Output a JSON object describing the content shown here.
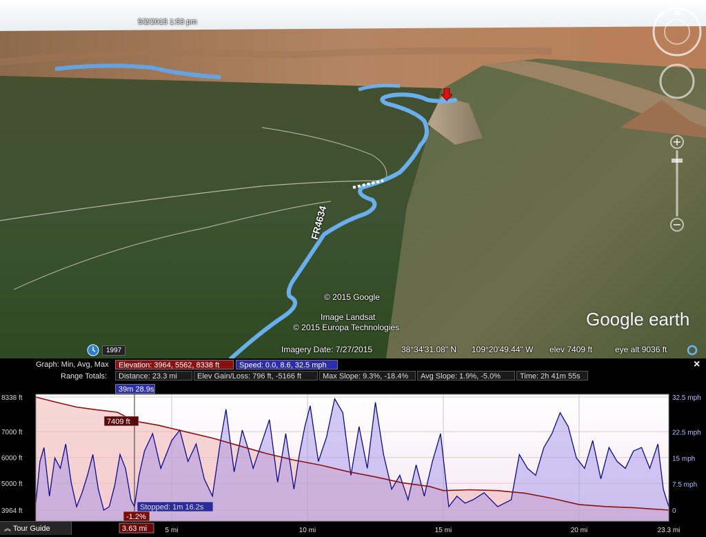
{
  "map": {
    "timestamp": "5/2/2015    1:53 pm",
    "road_label": "FR4634",
    "attribution": [
      "© 2015 Google",
      "Image Landsat",
      "© 2015 Europa Technologies"
    ],
    "logo": "Google earth",
    "historical_year": "1997",
    "status": {
      "imagery_date": "Imagery Date: 7/27/2015",
      "lat": "38°34'31.08\" N",
      "lon": "109°20'49.44\" W",
      "elev": "elev  7409 ft",
      "eye_alt": "eye alt   9036 ft"
    }
  },
  "graph_header": {
    "graph_label": "Graph: Min, Avg, Max",
    "elevation": "Elevation: 3964, 5562, 8338 ft",
    "speed": "Speed: 0.0, 8.6, 32.5 mph",
    "range_label": "Range Totals:",
    "distance": "Distance: 23.3 mi",
    "gain_loss": "Elev Gain/Loss: 796 ft, -5166 ft",
    "max_slope": "Max Slope: 9.3%, -18.4%",
    "avg_slope": "Avg Slope: 1.9%, -5.0%",
    "time": "Time: 2h 41m 55s",
    "close": "×"
  },
  "cursor": {
    "time": "39m 28.9s",
    "elevation": "7409 ft",
    "stopped": "Stopped: 1m 16.2s",
    "slope": "-1.2%",
    "distance": "3.63 mi",
    "distance_value": 3.63
  },
  "tour_guide": "Tour Guide",
  "colors": {
    "elevation": "#8b1010",
    "speed": "#0a0a8c",
    "route": "#5fa8f0"
  },
  "chart_data": {
    "type": "line",
    "xlim": [
      0,
      23.3
    ],
    "x_ticks": [
      "5 mi",
      "10 mi",
      "15 mi",
      "20 mi",
      "23.3 mi"
    ],
    "x_tick_values": [
      5,
      10,
      15,
      20,
      23.3
    ],
    "left_axis_ticks": [
      "8338 ft",
      "7000 ft",
      "6000 ft",
      "5000 ft",
      "3964 ft"
    ],
    "left_axis_values": [
      8338,
      7000,
      6000,
      5000,
      3964
    ],
    "right_axis_ticks": [
      "32.5 mph",
      "22.5 mph",
      "15 mph",
      "7.5 mph",
      "0"
    ],
    "right_axis_values": [
      32.5,
      22.5,
      15,
      7.5,
      0
    ],
    "series": [
      {
        "name": "Elevation",
        "unit": "ft",
        "x": [
          0,
          0.7,
          1.5,
          2.2,
          3,
          3.63,
          4.5,
          5.5,
          6.5,
          7.5,
          8.5,
          9.5,
          10.5,
          11.5,
          12.5,
          13.5,
          14.5,
          15,
          16,
          17,
          18,
          19,
          20,
          21,
          22,
          23.3
        ],
        "values": [
          8338,
          8150,
          7950,
          7850,
          7750,
          7409,
          7250,
          7000,
          6750,
          6450,
          6150,
          5900,
          5700,
          5450,
          5250,
          5020,
          4880,
          4720,
          4750,
          4720,
          4620,
          4420,
          4180,
          4100,
          4060,
          3964
        ]
      },
      {
        "name": "Speed",
        "unit": "mph",
        "x": [
          0,
          0.15,
          0.3,
          0.5,
          0.7,
          0.9,
          1.1,
          1.3,
          1.5,
          1.7,
          1.9,
          2.1,
          2.3,
          2.5,
          2.7,
          2.9,
          3.1,
          3.3,
          3.5,
          3.63,
          3.8,
          4.0,
          4.3,
          4.6,
          5.0,
          5.3,
          5.6,
          5.9,
          6.2,
          6.5,
          6.8,
          7.0,
          7.3,
          7.6,
          7.8,
          8.0,
          8.3,
          8.6,
          8.9,
          9.2,
          9.5,
          9.7,
          9.9,
          10.1,
          10.4,
          10.7,
          11.0,
          11.3,
          11.6,
          11.9,
          12.2,
          12.5,
          12.8,
          13.1,
          13.4,
          13.7,
          14.0,
          14.3,
          14.6,
          14.9,
          15.2,
          15.5,
          15.8,
          16.1,
          16.5,
          17.0,
          17.5,
          17.8,
          18.1,
          18.4,
          18.7,
          19.0,
          19.3,
          19.6,
          19.9,
          20.2,
          20.5,
          20.8,
          21.1,
          21.4,
          21.7,
          22.0,
          22.3,
          22.6,
          22.9,
          23.1,
          23.3
        ],
        "values": [
          2,
          14,
          18,
          4,
          15,
          12,
          19,
          8,
          1,
          5,
          10,
          16,
          6,
          0,
          1,
          7,
          16,
          12,
          3,
          1,
          10,
          17,
          22,
          12,
          20,
          23,
          14,
          19,
          9,
          4,
          20,
          29,
          11,
          23,
          18,
          12,
          19,
          26,
          8,
          22,
          6,
          16,
          24,
          30,
          14,
          21,
          32,
          28,
          10,
          24,
          12,
          31,
          16,
          6,
          10,
          3,
          13,
          4,
          14,
          22,
          1,
          4,
          2,
          3,
          5,
          1,
          3,
          16,
          12,
          10,
          18,
          22,
          28,
          24,
          15,
          12,
          20,
          9,
          18,
          14,
          12,
          17,
          18,
          12,
          19,
          6,
          1
        ]
      }
    ]
  }
}
